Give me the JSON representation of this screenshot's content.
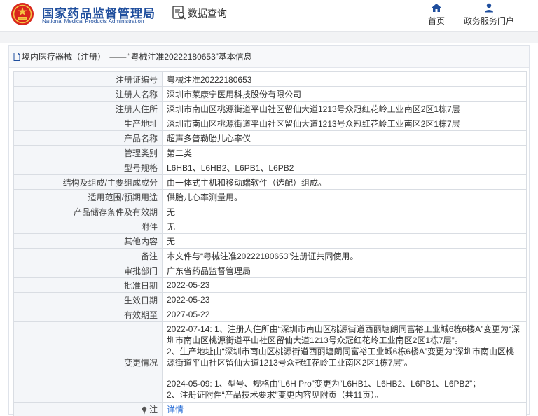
{
  "header": {
    "site_title_cn": "国家药品监督管理局",
    "site_title_en": "National Medical Products Administration",
    "search_label": "数据查询",
    "nav": [
      {
        "label": "首页",
        "icon": "home-icon"
      },
      {
        "label": "政务服务门户",
        "icon": "user-icon"
      }
    ]
  },
  "panel": {
    "breadcrumb_category": "境内医疗器械（注册）",
    "breadcrumb_separator": "——",
    "breadcrumb_title": "“粤械注准20222180653”基本信息"
  },
  "fields": [
    {
      "label": "注册证编号",
      "value": "粤械注准20222180653"
    },
    {
      "label": "注册人名称",
      "value": "深圳市莱康宁医用科技股份有限公司"
    },
    {
      "label": "注册人住所",
      "value": "深圳市南山区桃源街道平山社区留仙大道1213号众冠红花岭工业南区2区1栋7层"
    },
    {
      "label": "生产地址",
      "value": "深圳市南山区桃源街道平山社区留仙大道1213号众冠红花岭工业南区2区1栋7层"
    },
    {
      "label": "产品名称",
      "value": "超声多普勒胎儿心率仪"
    },
    {
      "label": "管理类别",
      "value": "第二类"
    },
    {
      "label": "型号规格",
      "value": "L6HB1、L6HB2、L6PB1、L6PB2"
    },
    {
      "label": "结构及组成/主要组成成分",
      "value": "由一体式主机和移动端软件（选配）组成。"
    },
    {
      "label": "适用范围/预期用途",
      "value": "供胎儿心率测量用。"
    },
    {
      "label": "产品储存条件及有效期",
      "value": "无"
    },
    {
      "label": "附件",
      "value": "无"
    },
    {
      "label": "其他内容",
      "value": "无"
    },
    {
      "label": "备注",
      "value": "本文件与“粤械注准20222180653”注册证共同使用。"
    },
    {
      "label": "审批部门",
      "value": "广东省药品监督管理局"
    },
    {
      "label": "批准日期",
      "value": "2022-05-23"
    },
    {
      "label": "生效日期",
      "value": "2022-05-23"
    },
    {
      "label": "有效期至",
      "value": "2027-05-22"
    }
  ],
  "changes": {
    "label": "变更情况",
    "para1": "2022-07-14: 1、注册人住所由“深圳市南山区桃源街道西丽塘朗同富裕工业城6栋6楼A”变更为“深圳市南山区桃源街道平山社区留仙大道1213号众冠红花岭工业南区2区1栋7层”。",
    "para2": "2、生产地址由“深圳市南山区桃源街道西丽塘朗同富裕工业城6栋6楼A”变更为“深圳市南山区桃源街道平山社区留仙大道1213号众冠红花岭工业南区2区1栋7层”。",
    "para3": "2024-05-09: 1、型号、规格由“L6H Pro”变更为“L6HB1、L6HB2、L6PB1、L6PB2”；",
    "para4": "2、注册证附件“产品技术要求”变更内容见附页（共11页）。"
  },
  "note": {
    "label": "注",
    "link": "详情"
  },
  "colors": {
    "brand_blue": "#1f4e9d",
    "link_blue": "#2b6fd6",
    "label_bg": "#f4f6f9"
  }
}
